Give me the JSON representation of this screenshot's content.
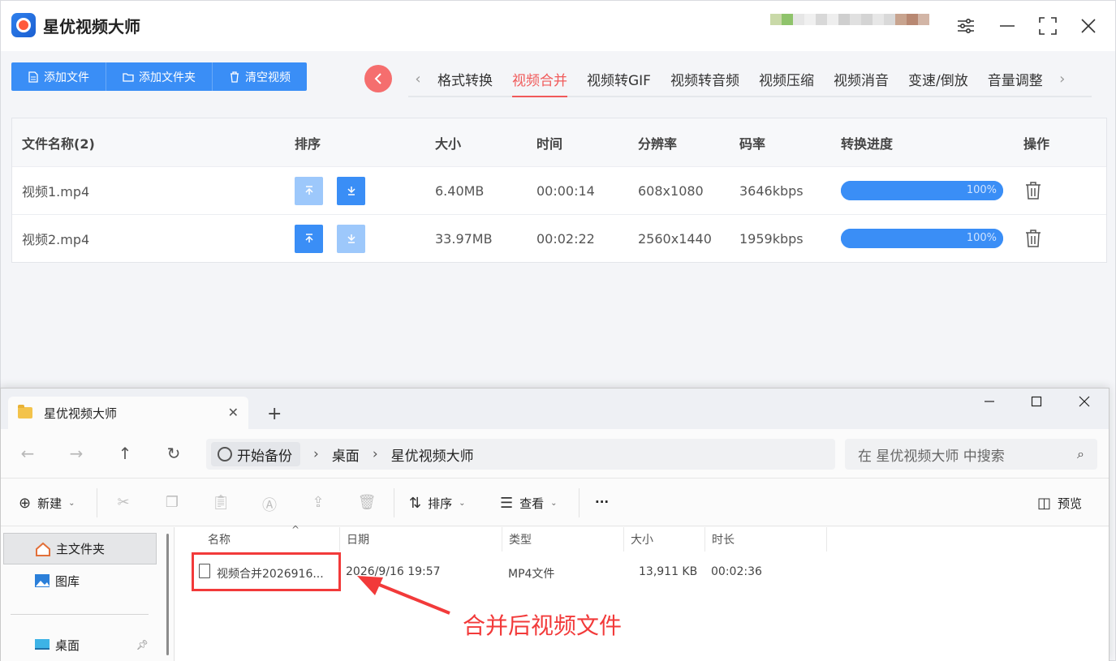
{
  "app": {
    "title": "星优视频大师",
    "toolbar": {
      "add_file": "添加文件",
      "add_folder": "添加文件夹",
      "clear": "清空视频"
    },
    "tabs": [
      "格式转换",
      "视频合并",
      "视频转GIF",
      "视频转音频",
      "视频压缩",
      "视频消音",
      "变速/倒放",
      "音量调整"
    ],
    "active_tab": "视频合并",
    "table": {
      "headers": [
        "文件名称(2)",
        "排序",
        "大小",
        "时间",
        "分辨率",
        "码率",
        "转换进度",
        "操作"
      ],
      "rows": [
        {
          "name": "视频1.mp4",
          "size": "6.40MB",
          "time": "00:00:14",
          "resolution": "608x1080",
          "bitrate": "3646kbps",
          "progress_label": "100%",
          "progress": 100,
          "up_enabled": false,
          "down_enabled": true
        },
        {
          "name": "视频2.mp4",
          "size": "33.97MB",
          "time": "00:02:22",
          "resolution": "2560x1440",
          "bitrate": "1959kbps",
          "progress_label": "100%",
          "progress": 100,
          "up_enabled": true,
          "down_enabled": false
        }
      ]
    },
    "colors": {
      "accent": "#3a8ef6",
      "active_tab": "#f05a5a",
      "annotation": "#f23a3a"
    }
  },
  "explorer": {
    "tab_title": "星优视频大师",
    "breadcrumb": [
      "开始备份",
      "桌面",
      "星优视频大师"
    ],
    "search_placeholder": "在 星优视频大师 中搜索",
    "commands": {
      "new": "新建",
      "sort": "排序",
      "view": "查看",
      "more": "···",
      "preview": "预览"
    },
    "sidebar": {
      "home": "主文件夹",
      "gallery": "图库",
      "desktop": "桌面"
    },
    "columns": [
      "名称",
      "日期",
      "类型",
      "大小",
      "时长"
    ],
    "files": [
      {
        "name": "视频合并2026916...",
        "date": "2026/9/16 19:57",
        "type": "MP4文件",
        "size": "13,911 KB",
        "duration": "00:02:36"
      }
    ]
  },
  "annotation": "合并后视频文件"
}
